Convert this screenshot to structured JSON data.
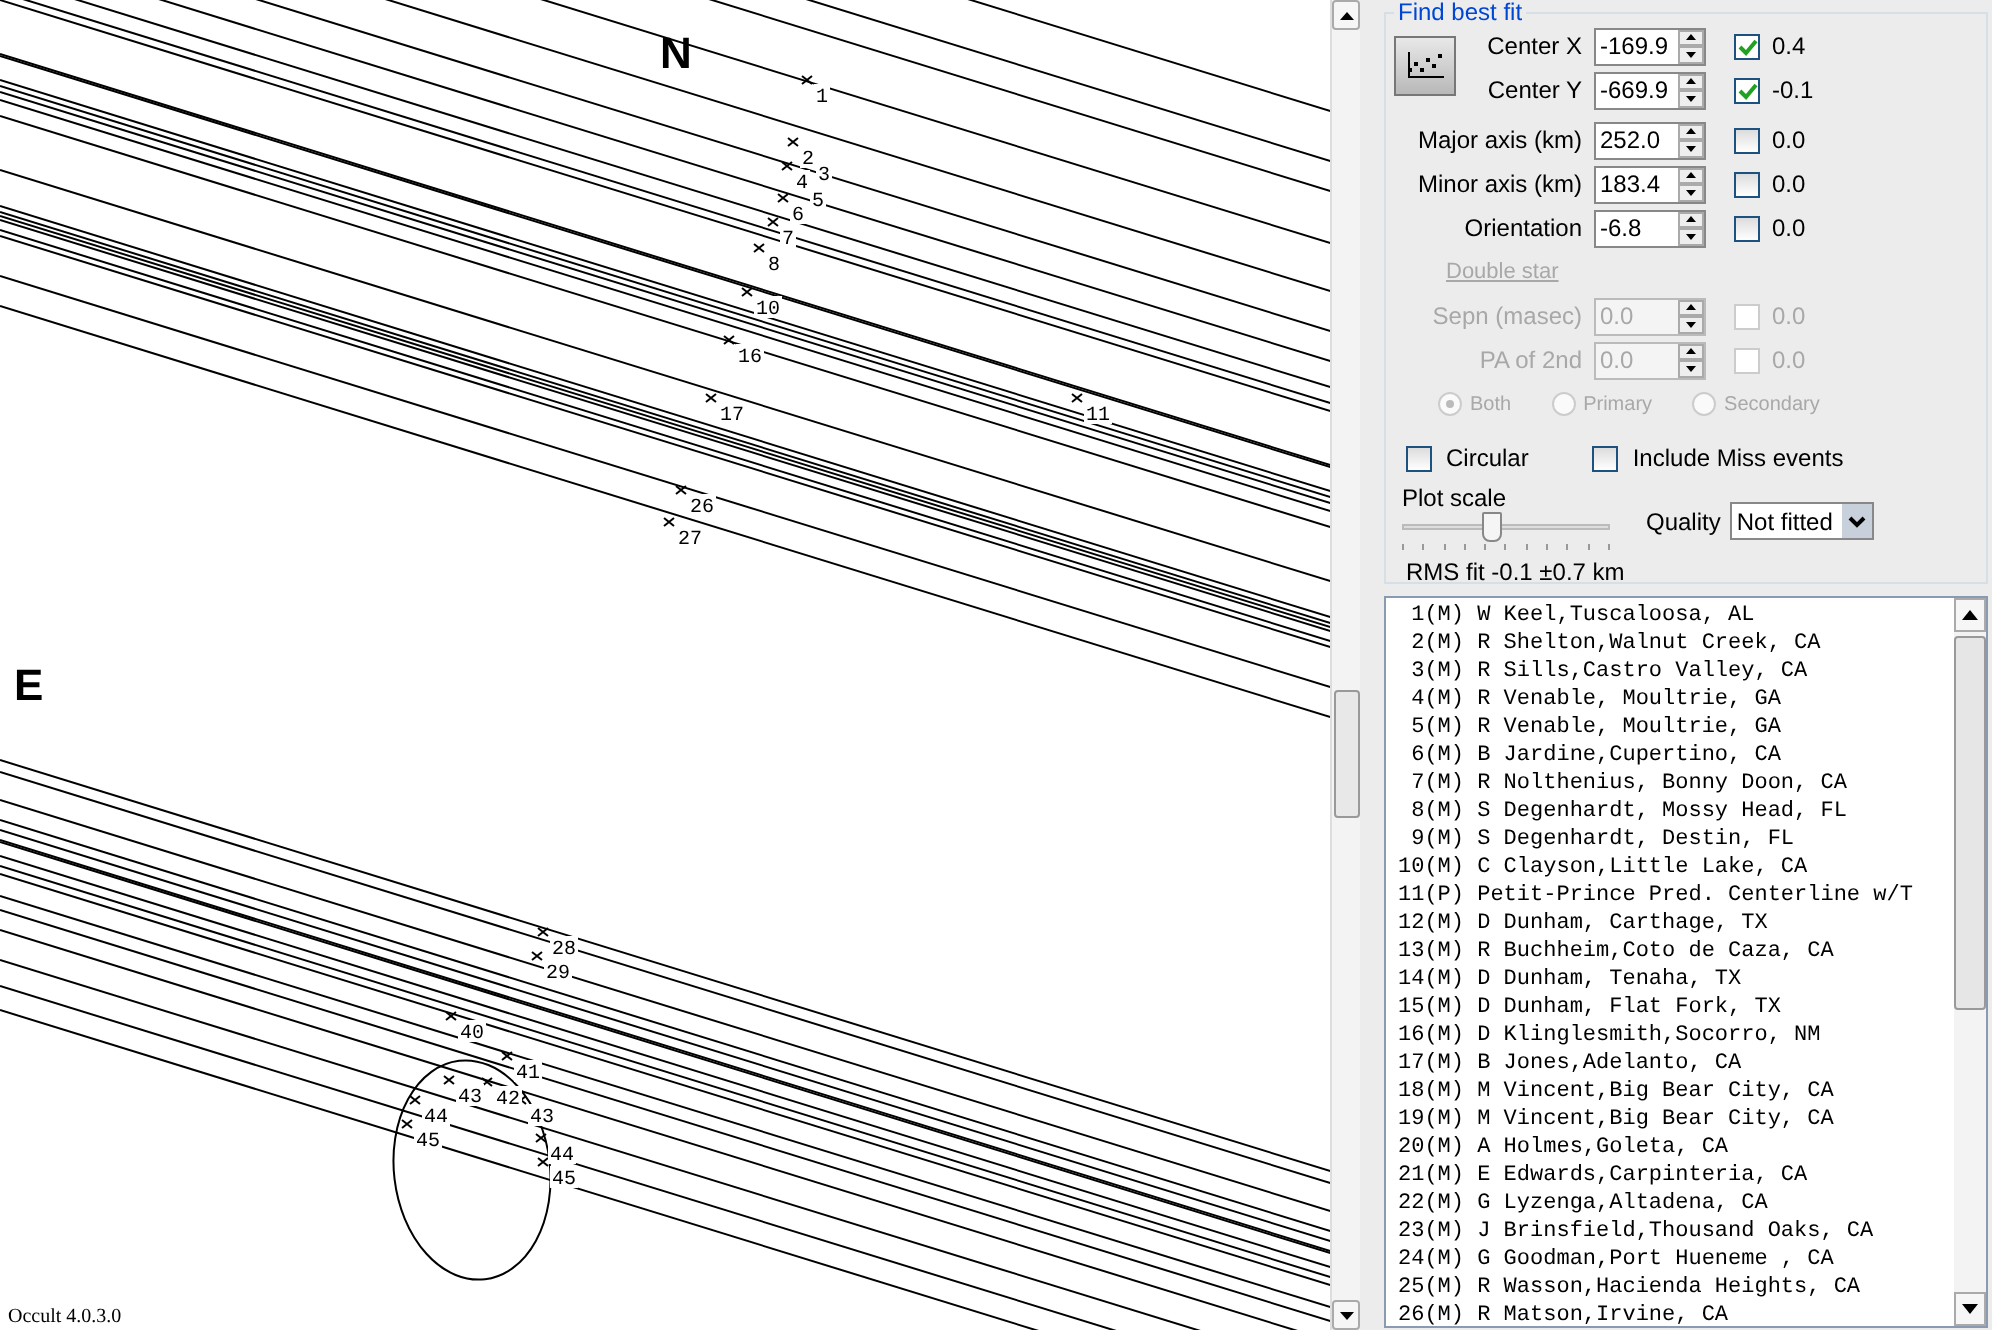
{
  "plot": {
    "compass": [
      {
        "kind": "north",
        "text": "N"
      },
      {
        "kind": "east",
        "text": "E"
      }
    ],
    "chord_labels": [
      "1",
      "2",
      "3",
      "4",
      "5",
      "6",
      "7",
      "8",
      "10",
      "11",
      "16",
      "17",
      "26",
      "27",
      "28",
      "29",
      "40",
      "41",
      "42",
      "43",
      "43",
      "44",
      "45",
      "44",
      "45"
    ],
    "version": "Occult 4.0.3.0"
  },
  "fit": {
    "title": "Find best fit",
    "params": [
      {
        "label": "Center X",
        "value": "-169.9",
        "checked": true,
        "result": "0.4"
      },
      {
        "label": "Center Y",
        "value": "-669.9",
        "checked": true,
        "result": "-0.1"
      },
      {
        "label": "Major axis (km)",
        "value": "252.0",
        "checked": false,
        "result": "0.0"
      },
      {
        "label": "Minor axis (km)",
        "value": "183.4",
        "checked": false,
        "result": "0.0"
      },
      {
        "label": "Orientation",
        "value": "-6.8",
        "checked": false,
        "result": "0.0"
      }
    ],
    "double_star": {
      "label": "Double star",
      "disabled": true,
      "params": [
        {
          "label": "Sepn (masec)",
          "value": "0.0",
          "checked": false,
          "result": "0.0"
        },
        {
          "label": "PA of 2nd",
          "value": "0.0",
          "checked": false,
          "result": "0.0"
        }
      ],
      "radios": [
        {
          "label": "Both",
          "selected": true
        },
        {
          "label": "Primary",
          "selected": false
        },
        {
          "label": "Secondary",
          "selected": false
        }
      ]
    },
    "options": [
      {
        "label": "Circular",
        "checked": false
      },
      {
        "label": "Include Miss events",
        "checked": false
      }
    ],
    "plot_scale": {
      "label": "Plot scale",
      "level": 0.42
    },
    "quality": {
      "label": "Quality",
      "value": "Not fitted"
    },
    "rms": "RMS fit -0.1 ±0.7 km"
  },
  "observers": [
    " 1(M) W Keel,Tuscaloosa, AL",
    " 2(M) R Shelton,Walnut Creek, CA",
    " 3(M) R Sills,Castro Valley, CA",
    " 4(M) R Venable, Moultrie, GA",
    " 5(M) R Venable, Moultrie, GA",
    " 6(M) B Jardine,Cupertino, CA",
    " 7(M) R Nolthenius, Bonny Doon, CA",
    " 8(M) S Degenhardt, Mossy Head, FL",
    " 9(M) S Degenhardt, Destin, FL",
    "10(M) C Clayson,Little Lake, CA",
    "11(P) Petit-Prince Pred. Centerline w/T",
    "12(M) D Dunham, Carthage, TX",
    "13(M) R Buchheim,Coto de Caza, CA",
    "14(M) D Dunham, Tenaha, TX",
    "15(M) D Dunham, Flat Fork, TX",
    "16(M) D Klinglesmith,Socorro, NM",
    "17(M) B Jones,Adelanto, CA",
    "18(M) M Vincent,Big Bear City, CA",
    "19(M) M Vincent,Big Bear City, CA",
    "20(M) A Holmes,Goleta, CA",
    "21(M) E Edwards,Carpinteria, CA",
    "22(M) G Lyzenga,Altadena, CA",
    "23(M) J Brinsfield,Thousand Oaks, CA",
    "24(M) G Goodman,Port Hueneme , CA",
    "25(M) R Wasson,Hacienda Heights, CA",
    "26(M) R Matson,Irvine, CA"
  ]
}
